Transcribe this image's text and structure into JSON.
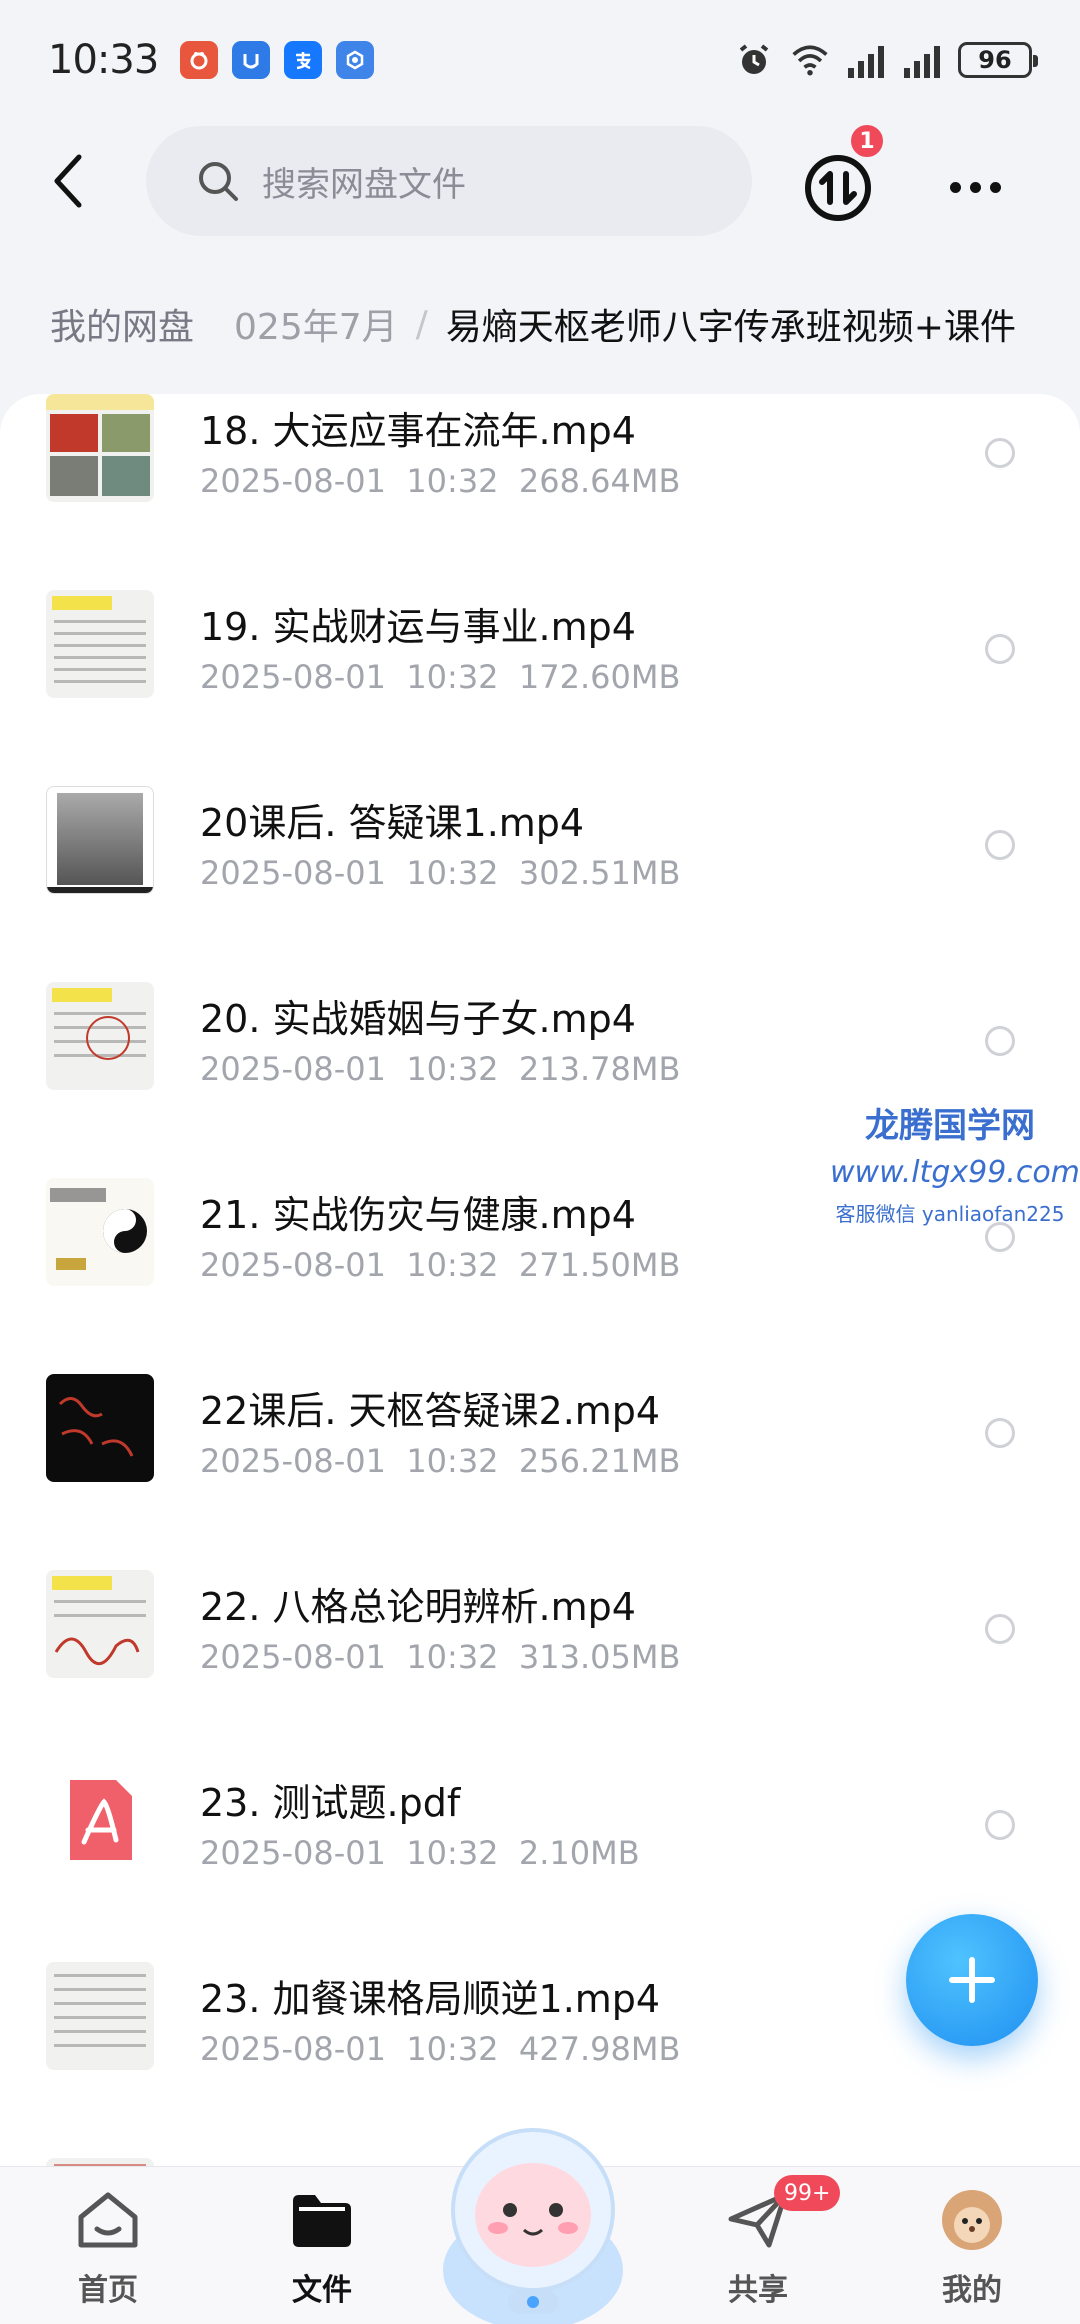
{
  "status_bar": {
    "time": "10:33",
    "notification_icons": [
      "baidu-app-icon",
      "taobao-icon",
      "alipay-icon",
      "app-icon"
    ],
    "battery": "96"
  },
  "top_bar": {
    "search_placeholder": "搜索网盘文件",
    "transfer_badge": "1"
  },
  "breadcrumb": {
    "root": "我的网盘",
    "middle": "025年7月",
    "separator": "/",
    "current": "易熵天枢老师八字传承班视频+课件"
  },
  "files": [
    {
      "name": "18. 大运应事在流年.mp4",
      "date": "2025-08-01",
      "time": "10:32",
      "size": "268.64MB",
      "thumb": "photo"
    },
    {
      "name": "19. 实战财运与事业.mp4",
      "date": "2025-08-01",
      "time": "10:32",
      "size": "172.60MB",
      "thumb": "doc"
    },
    {
      "name": "20课后. 答疑课1.mp4",
      "date": "2025-08-01",
      "time": "10:32",
      "size": "302.51MB",
      "thumb": "screen"
    },
    {
      "name": "20. 实战婚姻与子女.mp4",
      "date": "2025-08-01",
      "time": "10:32",
      "size": "213.78MB",
      "thumb": "doc"
    },
    {
      "name": "21. 实战伤灾与健康.mp4",
      "date": "2025-08-01",
      "time": "10:32",
      "size": "271.50MB",
      "thumb": "bagua"
    },
    {
      "name": "22课后. 天枢答疑课2.mp4",
      "date": "2025-08-01",
      "time": "10:32",
      "size": "256.21MB",
      "thumb": "dark"
    },
    {
      "name": "22. 八格总论明辨析.mp4",
      "date": "2025-08-01",
      "time": "10:32",
      "size": "313.05MB",
      "thumb": "doc"
    },
    {
      "name": "23. 测试题.pdf",
      "date": "2025-08-01",
      "time": "10:32",
      "size": "2.10MB",
      "thumb": "pdf"
    },
    {
      "name": "23. 加餐课格局顺逆1.mp4",
      "date": "2025-08-01",
      "time": "10:32",
      "size": "427.98MB",
      "thumb": "doc"
    }
  ],
  "watermark": {
    "title": "龙腾国学网",
    "url": "www.ltgx99.com",
    "contact": "客服微信 yanliaofan225"
  },
  "bottom_nav": {
    "home": "首页",
    "files": "文件",
    "share": "共享",
    "share_badge": "99+",
    "mine": "我的"
  },
  "colors": {
    "accent": "#1f8ff0",
    "badge": "#f04a5a",
    "watermark": "#3a6fd0"
  }
}
